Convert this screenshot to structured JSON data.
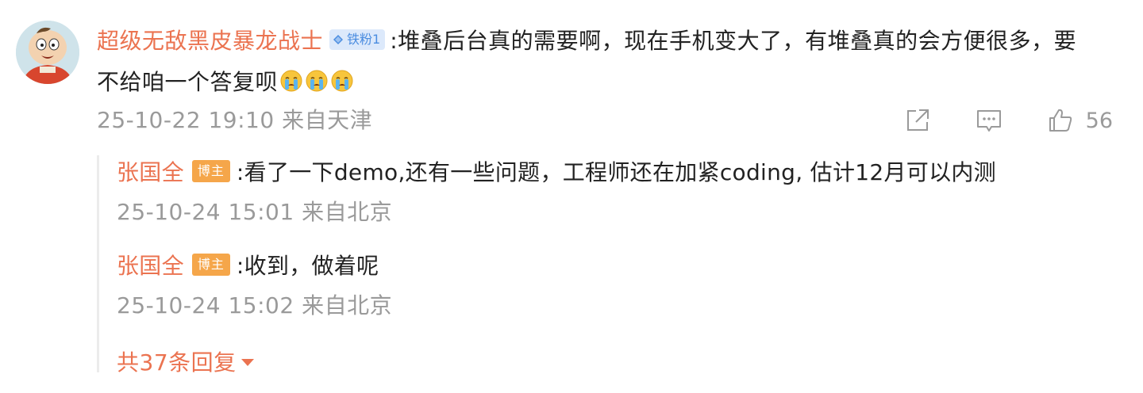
{
  "comment": {
    "username": "超级无敌黑皮暴龙战士",
    "fan_badge": "铁粉1",
    "separator": ":",
    "text": "堆叠后台真的需要啊，现在手机变大了，有堆叠真的会方便很多，要不给咱一个答复呗",
    "emojis": [
      "crying-face-icon",
      "crying-face-icon",
      "crying-face-icon"
    ],
    "timestamp": "25-10-22 19:10",
    "location": "来自天津",
    "like_count": "56"
  },
  "replies": [
    {
      "username": "张国全",
      "badge": "博主",
      "separator": ":",
      "text": "看了一下demo,还有一些问题，工程师还在加紧coding, 估计12月可以内测",
      "timestamp": "25-10-24 15:01",
      "location": "来自北京"
    },
    {
      "username": "张国全",
      "badge": "博主",
      "separator": ":",
      "text": "收到，做着呢",
      "timestamp": "25-10-24 15:02",
      "location": "来自北京"
    }
  ],
  "more_replies_label": "共37条回复",
  "colors": {
    "username": "#eb7350",
    "meta": "#9a9a9a",
    "fan_badge_bg": "#dce9fb",
    "fan_badge_text": "#4b8de0",
    "blogger_badge_bg": "#f5a64a"
  }
}
